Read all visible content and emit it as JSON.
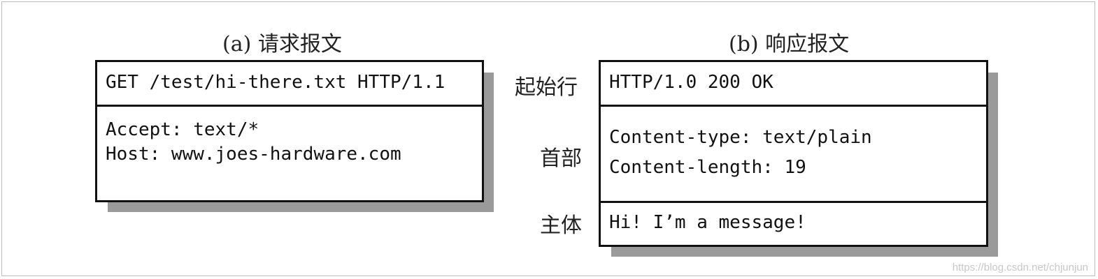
{
  "request": {
    "caption": "(a) 请求报文",
    "start_line": "GET /test/hi-there.txt HTTP/1.1",
    "headers": [
      "Accept: text/*",
      "Host: www.joes-hardware.com"
    ]
  },
  "response": {
    "caption": "(b) 响应报文",
    "start_line": "HTTP/1.0 200 OK",
    "headers": [
      "Content-type: text/plain",
      "Content-length: 19"
    ],
    "body": "Hi! I’m a message!"
  },
  "labels": {
    "start_line": "起始行",
    "headers": "首部",
    "body": "主体"
  },
  "watermark": "https://blog.csdn.net/chjunjun"
}
